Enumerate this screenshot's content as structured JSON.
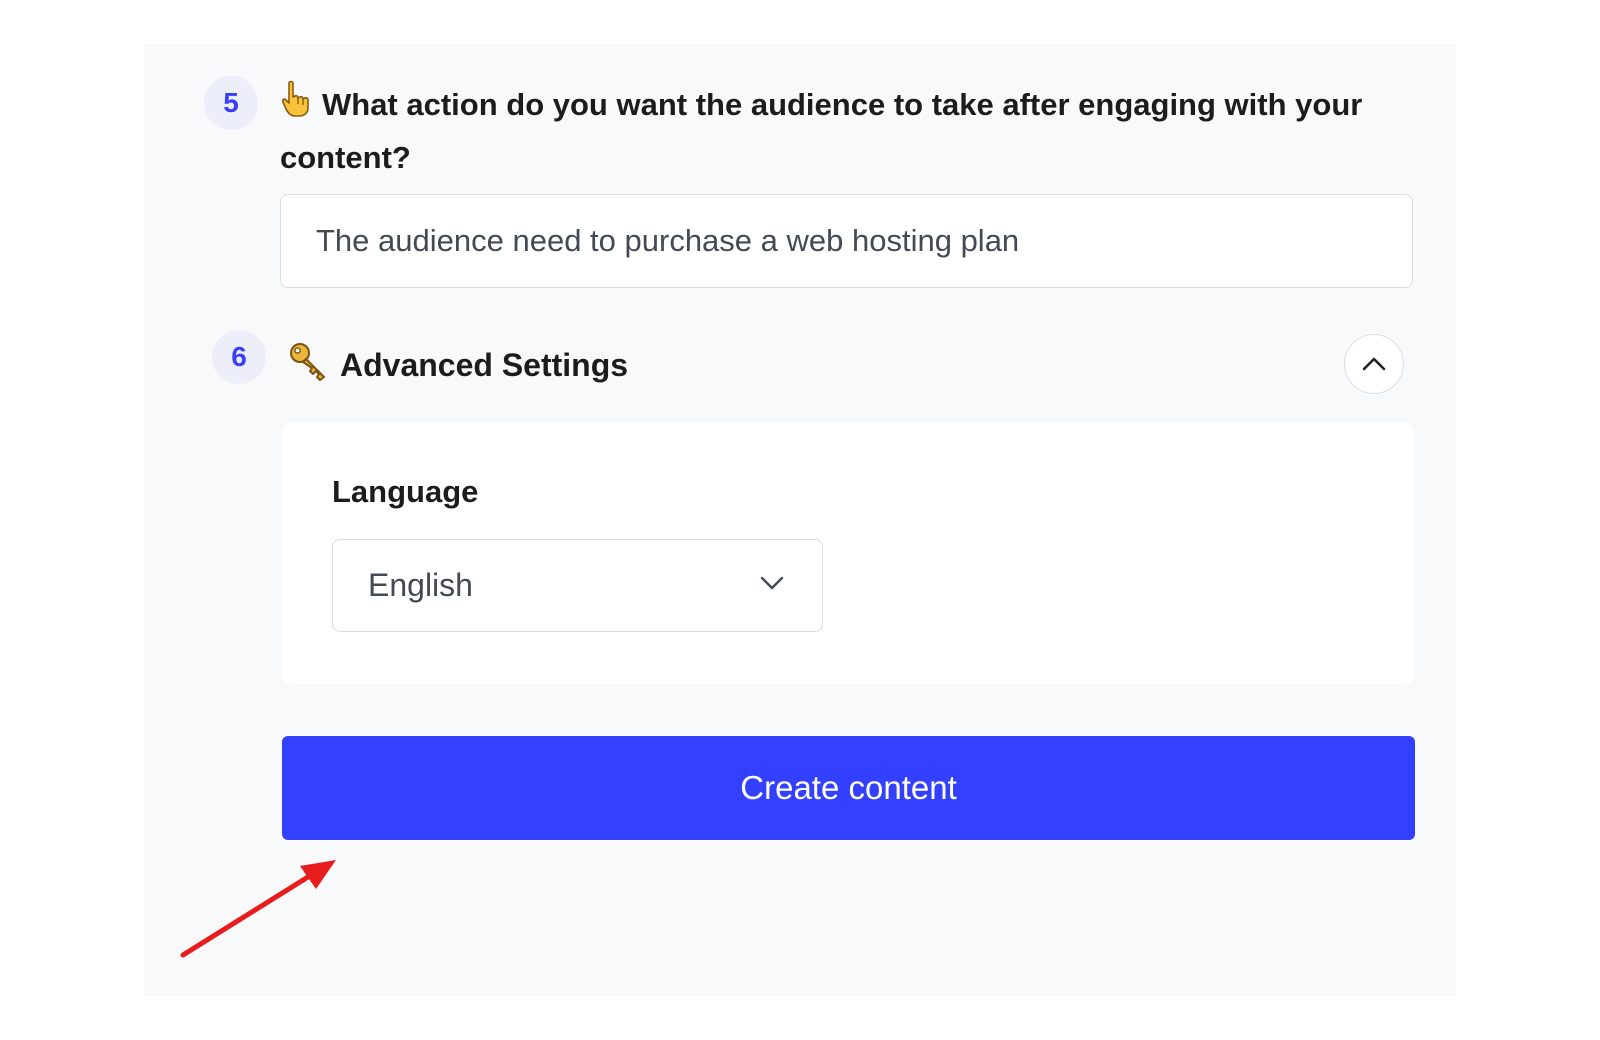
{
  "colors": {
    "accent": "#3340ff",
    "badge_text": "#3a3ff5",
    "badge_bg": "#eceefa",
    "panel_bg": "#f8f9fb",
    "annotation_arrow": "#e81c1c"
  },
  "step5": {
    "number": "5",
    "icon": "pointing-hand-icon",
    "question": "What action do you want the audience to take after engaging with your content?",
    "answer_value": "The audience need to purchase a web hosting plan"
  },
  "step6": {
    "number": "6",
    "icon": "key-icon",
    "title": "Advanced Settings",
    "toggle_icon": "chevron-up-icon",
    "language": {
      "label": "Language",
      "selected": "English",
      "dropdown_icon": "chevron-down-icon"
    }
  },
  "submit": {
    "label": "Create content"
  },
  "annotation": {
    "icon": "red-arrow-icon"
  }
}
